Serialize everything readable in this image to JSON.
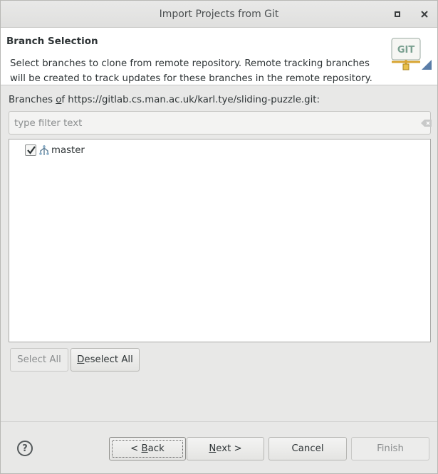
{
  "window": {
    "title": "Import Projects from Git"
  },
  "header": {
    "title": "Branch Selection",
    "description": "Select branches to clone from remote repository. Remote tracking branches will be created to track updates for these branches in the remote repository.",
    "logo_text": "GIT"
  },
  "branches": {
    "label_prefix": "Branches ",
    "label_mnemonic": "o",
    "label_rest": "f https://gitlab.cs.man.ac.uk/karl.tye/sliding-puzzle.git:",
    "filter_placeholder": "type filter text",
    "filter_value": "",
    "items": [
      {
        "label": "master",
        "checked": true
      }
    ]
  },
  "selection_buttons": {
    "select_all": "Select All",
    "deselect_mnemonic": "D",
    "deselect_rest": "eselect All"
  },
  "footer": {
    "help_glyph": "?",
    "back_prefix": "< ",
    "back_mnemonic": "B",
    "back_rest": "ack",
    "next_mnemonic": "N",
    "next_rest": "ext >",
    "cancel": "Cancel",
    "finish": "Finish"
  },
  "icons": {
    "maximize": "maximize-icon",
    "close": "close-icon",
    "clear": "clear-filter-icon",
    "branch": "branch-icon",
    "help": "help-icon"
  }
}
